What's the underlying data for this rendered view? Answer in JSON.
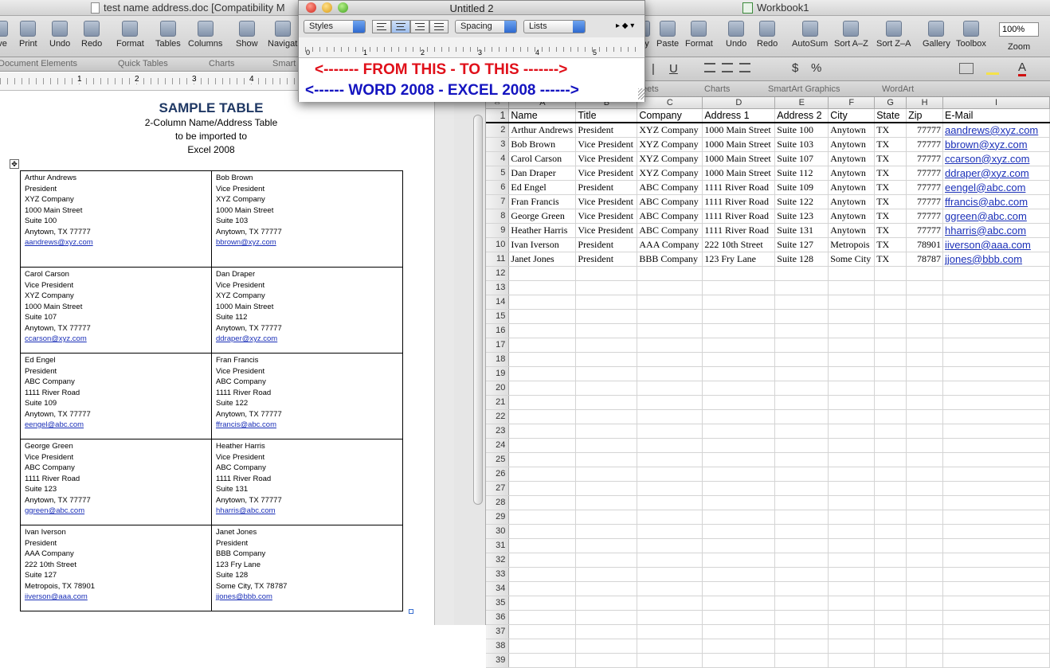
{
  "word": {
    "window_title": "test name address.doc [Compatibility M",
    "toolbar": [
      "ave",
      "Print",
      "Undo",
      "Redo",
      "Format",
      "Tables",
      "Columns",
      "Show",
      "Navigat"
    ],
    "ribbon": [
      "Document Elements",
      "Quick Tables",
      "Charts",
      "Smart"
    ],
    "ruler": [
      "1",
      "2",
      "3",
      "4"
    ],
    "doc": {
      "title": "SAMPLE TABLE",
      "subtitle": [
        "2-Column Name/Address Table",
        "to be imported to",
        "Excel 2008"
      ]
    },
    "cells": [
      [
        "Arthur Andrews",
        "President",
        "XYZ Company",
        "1000 Main Street",
        "Suite 100",
        "Anytown, TX 77777",
        "aandrews@xyz.com"
      ],
      [
        "Bob Brown",
        "Vice President",
        "XYZ Company",
        "1000 Main Street",
        "Suite 103",
        "Anytown, TX 77777",
        "bbrown@xyz.com"
      ],
      [
        "Carol Carson",
        "Vice President",
        "XYZ Company",
        "1000 Main Street",
        "Suite 107",
        "Anytown, TX 77777",
        "ccarson@xyz.com"
      ],
      [
        "Dan Draper",
        "Vice President",
        "XYZ Company",
        "1000 Main Street",
        "Suite 112",
        "Anytown, TX 77777",
        "ddraper@xyz.com"
      ],
      [
        "Ed Engel",
        "President",
        "ABC Company",
        "1111 River Road",
        "Suite 109",
        "Anytown, TX 77777",
        "eengel@abc.com"
      ],
      [
        "Fran Francis",
        "Vice President",
        "ABC Company",
        "1111 River Road",
        "Suite 122",
        "Anytown, TX 77777",
        "ffrancis@abc.com"
      ],
      [
        "George Green",
        "Vice President",
        "ABC Company",
        "1111 River Road",
        "Suite 123",
        "Anytown, TX 77777",
        "ggreen@abc.com"
      ],
      [
        "Heather Harris",
        "Vice President",
        "ABC Company",
        "1111 River Road",
        "Suite 131",
        "Anytown, TX 77777",
        "hharris@abc.com"
      ],
      [
        "Ivan Iverson",
        "President",
        "AAA Company",
        "222 10th Street",
        "Suite 127",
        "Metropois, TX 78901",
        "iiverson@aaa.com"
      ],
      [
        "Janet Jones",
        "President",
        "BBB Company",
        "123 Fry Lane",
        "Suite 128",
        "Some City, TX 78787",
        "jjones@bbb.com"
      ]
    ]
  },
  "float": {
    "title": "Untitled 2",
    "styles": "Styles",
    "spacing": "Spacing",
    "lists": "Lists",
    "ruler": [
      "0",
      "1",
      "2",
      "3",
      "4",
      "5"
    ],
    "line1": "<-------  FROM THIS - TO THIS ------->",
    "line2": "<------  WORD 2008 - EXCEL 2008 ------>",
    "colors": {
      "line1": "#e0101a",
      "line2": "#1414c0"
    }
  },
  "excel": {
    "window_title": "Workbook1",
    "toolbar": [
      "y",
      "Paste",
      "Format",
      "Undo",
      "Redo",
      "AutoSum",
      "Sort A–Z",
      "Sort Z–A",
      "Gallery",
      "Toolbox",
      "Zoom"
    ],
    "zoom": "100%",
    "fmt_sample": [
      "U",
      "$",
      "%"
    ],
    "ribbon": [
      "eets",
      "Charts",
      "SmartArt Graphics",
      "WordArt"
    ],
    "columns": [
      "A",
      "B",
      "C",
      "D",
      "E",
      "F",
      "G",
      "H",
      "I"
    ],
    "headers": [
      "Name",
      "Title",
      "Company",
      "Address 1",
      "Address 2",
      "City",
      "State",
      "Zip",
      "E-Mail"
    ],
    "rows": [
      [
        "Arthur Andrews",
        "President",
        "XYZ Company",
        "1000 Main Street",
        "Suite 100",
        "Anytown",
        "TX",
        "77777",
        "aandrews@xyz.com"
      ],
      [
        "Bob Brown",
        "Vice President",
        "XYZ Company",
        "1000 Main Street",
        "Suite 103",
        "Anytown",
        "TX",
        "77777",
        "bbrown@xyz.com"
      ],
      [
        "Carol Carson",
        "Vice President",
        "XYZ Company",
        "1000 Main Street",
        "Suite 107",
        "Anytown",
        "TX",
        "77777",
        "ccarson@xyz.com"
      ],
      [
        "Dan Draper",
        "Vice President",
        "XYZ Company",
        "1000 Main Street",
        "Suite 112",
        "Anytown",
        "TX",
        "77777",
        "ddraper@xyz.com"
      ],
      [
        "Ed Engel",
        "President",
        "ABC Company",
        "1111 River Road",
        "Suite 109",
        "Anytown",
        "TX",
        "77777",
        "eengel@abc.com"
      ],
      [
        "Fran Francis",
        "Vice President",
        "ABC Company",
        "1111 River Road",
        "Suite 122",
        "Anytown",
        "TX",
        "77777",
        "ffrancis@abc.com"
      ],
      [
        "George Green",
        "Vice President",
        "ABC Company",
        "1111 River Road",
        "Suite 123",
        "Anytown",
        "TX",
        "77777",
        "ggreen@abc.com"
      ],
      [
        "Heather Harris",
        "Vice President",
        "ABC Company",
        "1111 River Road",
        "Suite 131",
        "Anytown",
        "TX",
        "77777",
        "hharris@abc.com"
      ],
      [
        "Ivan Iverson",
        "President",
        "AAA Company",
        "222 10th Street",
        "Suite 127",
        "Metropois",
        "TX",
        "78901",
        "iiverson@aaa.com"
      ],
      [
        "Janet Jones",
        "President",
        "BBB Company",
        "123 Fry Lane",
        "Suite 128",
        "Some City",
        "TX",
        "78787",
        "jjones@bbb.com"
      ]
    ],
    "total_rows": 39
  }
}
